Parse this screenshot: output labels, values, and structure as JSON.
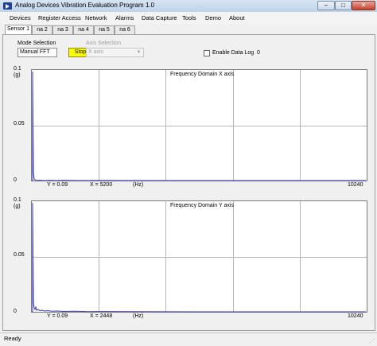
{
  "window": {
    "title": "Analog Devices Vibration Evaluation Program  1.0",
    "min": "–",
    "max": "□",
    "close": "✕"
  },
  "menu": [
    "Devices",
    "Register Access",
    "Network",
    "Alarms",
    "Data Capture",
    "Tools",
    "Demo",
    "About"
  ],
  "tabs": [
    "Sensor 1",
    "na 2",
    "na 3",
    "na 4",
    "na 5",
    "na 6"
  ],
  "controls": {
    "mode_label": "Mode Selection",
    "mode_value": "Manual FFT",
    "stop_label": "Stop",
    "axis_label": "Axis Selection",
    "axis_value": "X axis",
    "datalog_label": "Enable Data Log",
    "datalog_count": "0"
  },
  "plots": [
    {
      "title": "Frequency Domain X axis",
      "y_top": "0.1",
      "y_unit": "(g)",
      "y_mid": "0.05",
      "y_zero": "0",
      "y_readout": "Y = 0.09",
      "x_readout": "X = 5200",
      "x_unit": "(Hz)",
      "x_max": "10240"
    },
    {
      "title": "Frequency Domain Y axis",
      "y_top": "0.1",
      "y_unit": "(g)",
      "y_mid": "0.05",
      "y_zero": "0",
      "y_readout": "Y = 0.09",
      "x_readout": "X = 2448",
      "x_unit": "(Hz)",
      "x_max": "10240"
    }
  ],
  "status": {
    "text": "Ready"
  },
  "colors": {
    "trace": "#3a3ab8",
    "stop_button": "#ffff00"
  }
}
